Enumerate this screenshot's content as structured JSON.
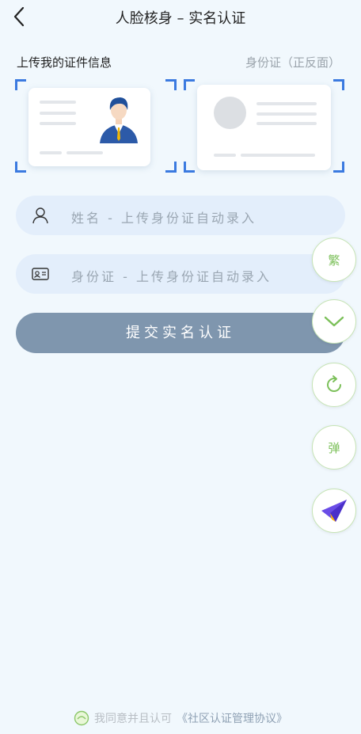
{
  "header": {
    "title": "人脸核身 – 实名认证"
  },
  "section": {
    "title": "上传我的证件信息",
    "hint": "身份证（正反面）"
  },
  "form": {
    "name_placeholder": "姓名 - 上传身份证自动录入",
    "id_placeholder": "身份证 - 上传身份证自动录入"
  },
  "submit": {
    "label": "提交实名认证"
  },
  "floating_buttons": [
    {
      "name": "traditional-chinese-button",
      "label": "繁"
    },
    {
      "name": "collapse-button",
      "icon": "chevron-down-icon"
    },
    {
      "name": "refresh-button",
      "icon": "refresh-icon"
    },
    {
      "name": "popup-button",
      "label": "弹"
    },
    {
      "name": "send-button",
      "icon": "paper-plane-icon"
    }
  ],
  "footer": {
    "agree_text": "我同意并且认可",
    "agreement_link": "《社区认证管理协议》"
  },
  "colors": {
    "accent_blue": "#3b7ae0",
    "button_gray_blue": "#7f96ae",
    "fab_green": "#7cc05a",
    "field_bg": "#e3eefb"
  }
}
